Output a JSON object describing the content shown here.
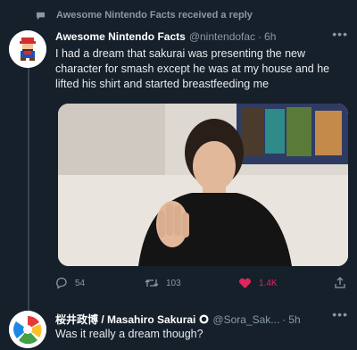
{
  "notice": {
    "text": "Awesome Nintendo Facts received a reply"
  },
  "tweet": {
    "name": "Awesome Nintendo Facts",
    "handle": "@nintendofac",
    "time": "6h",
    "text": "I had a dream that sakurai was presenting the new character for smash except he was at my house and he lifted his shirt and started breastfeeding me",
    "stats": {
      "replies": "54",
      "retweets": "103",
      "likes": "1.4K"
    },
    "like_color": "#e0245e"
  },
  "reply": {
    "name": "桜井政博 / Masahiro Sakurai",
    "handle": "@Sora_Sak...",
    "time": "5h",
    "text": "Was it really a dream though?"
  },
  "icons": [
    "comment-bubble-icon",
    "reply-icon",
    "retweet-icon",
    "heart-icon",
    "share-icon",
    "more-icon",
    "verified-badge-icon"
  ],
  "theme": {
    "background": "#15202b",
    "muted": "#8899a6",
    "line": "#38444d"
  }
}
